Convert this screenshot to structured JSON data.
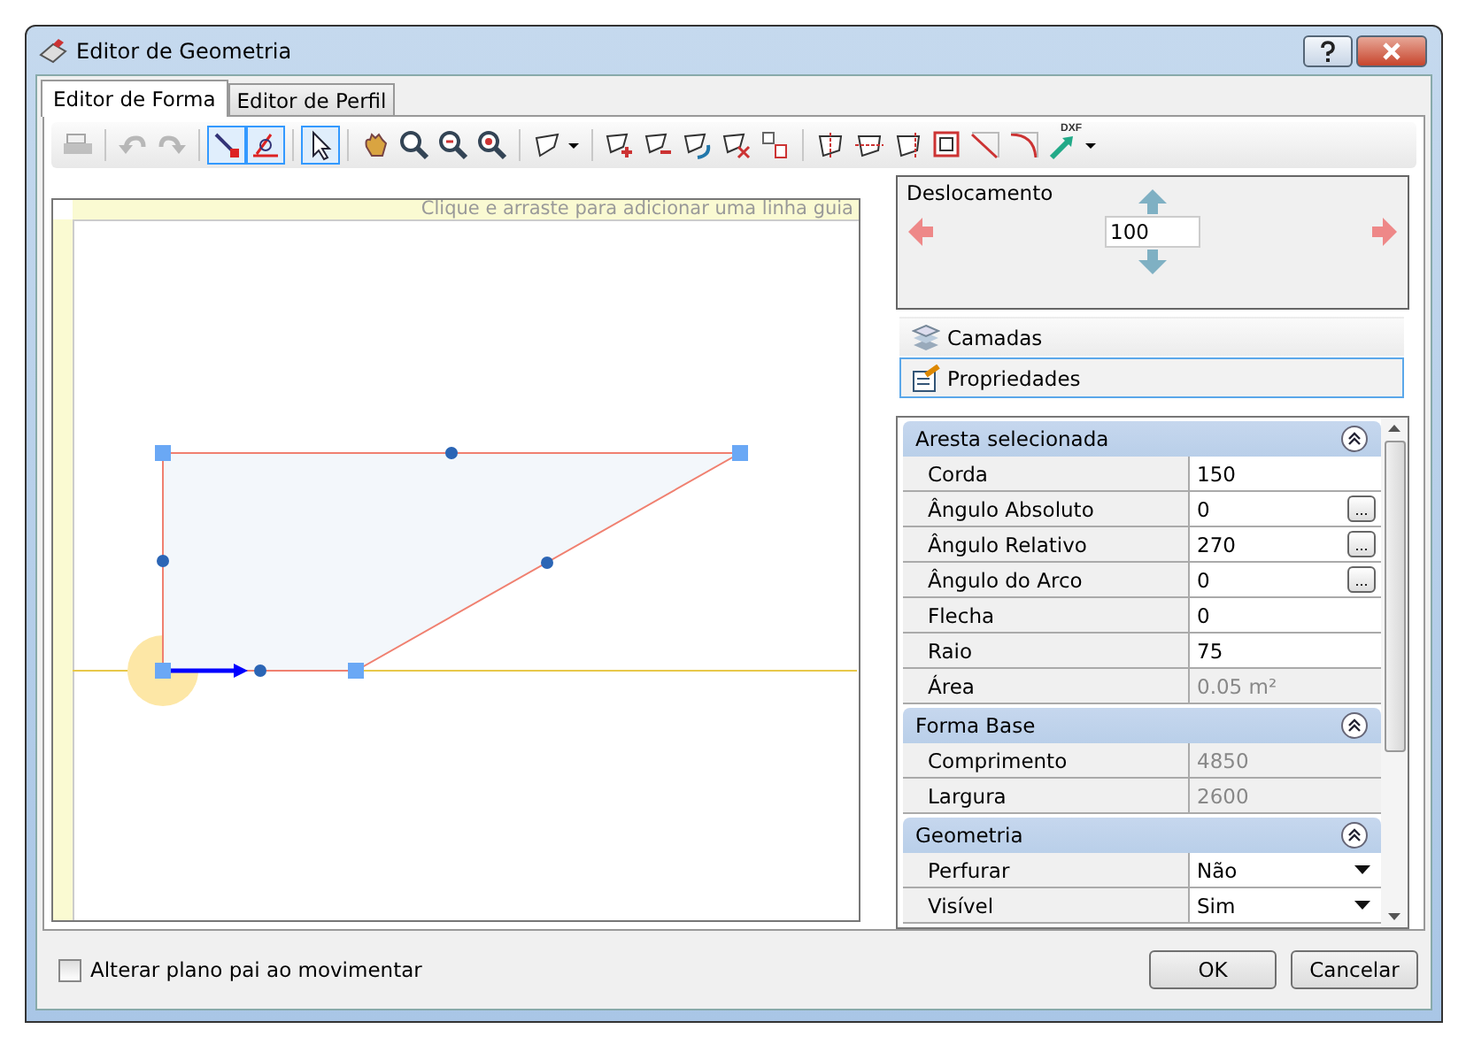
{
  "window": {
    "title": "Editor de Geometria"
  },
  "tabs": [
    {
      "label": "Editor de Forma",
      "selected": true
    },
    {
      "label": "Editor de Perfil",
      "selected": false
    }
  ],
  "toolbar": [
    {
      "selected": false,
      "disabled": true
    },
    {
      "selected": false,
      "disabled": true
    },
    {
      "selected": false,
      "disabled": true
    },
    {
      "selected": true,
      "disabled": false
    },
    {
      "selected": true,
      "disabled": false
    },
    {
      "selected": true,
      "disabled": false
    },
    {
      "selected": false,
      "disabled": false
    },
    {
      "selected": false,
      "disabled": false
    },
    {
      "selected": false,
      "disabled": false
    },
    {
      "selected": false,
      "disabled": false
    },
    {
      "selected": false,
      "disabled": false
    },
    {
      "selected": false,
      "disabled": false
    },
    {
      "selected": false,
      "disabled": false
    },
    {
      "selected": false,
      "disabled": false
    },
    {
      "selected": false,
      "disabled": false
    },
    {
      "selected": false,
      "disabled": false
    },
    {
      "selected": false,
      "disabled": false
    },
    {
      "selected": false,
      "disabled": false
    },
    {
      "selected": false,
      "disabled": false
    },
    {
      "selected": false,
      "disabled": false
    },
    {
      "selected": false,
      "disabled": false
    },
    {
      "selected": false,
      "disabled": false
    },
    {
      "selected": false,
      "disabled": false
    }
  ],
  "dxf_label": "DXF",
  "canvas": {
    "guide_hint": "Clique e arraste para adicionar uma linha guia"
  },
  "offset": {
    "title": "Deslocamento",
    "value": "100"
  },
  "panels": [
    {
      "label": "Camadas",
      "selected": false
    },
    {
      "label": "Propriedades",
      "selected": true
    }
  ],
  "sections": [
    {
      "title": "Aresta selecionada",
      "expanded": true,
      "rows": [
        {
          "label": "Corda",
          "value": "150",
          "kind": "text"
        },
        {
          "label": "Ângulo Absoluto",
          "value": "0",
          "kind": "button"
        },
        {
          "label": "Ângulo Relativo",
          "value": "270",
          "kind": "button"
        },
        {
          "label": "Ângulo do Arco",
          "value": "0",
          "kind": "button"
        },
        {
          "label": "Flecha",
          "value": "0",
          "kind": "text"
        },
        {
          "label": "Raio",
          "value": "75",
          "kind": "text"
        },
        {
          "label": "Área",
          "value": "0.05 m²",
          "kind": "readonly"
        }
      ]
    },
    {
      "title": "Forma Base",
      "expanded": true,
      "rows": [
        {
          "label": "Comprimento",
          "value": "4850",
          "kind": "readonly"
        },
        {
          "label": "Largura",
          "value": "2600",
          "kind": "readonly"
        }
      ]
    },
    {
      "title": "Geometria",
      "expanded": true,
      "rows": [
        {
          "label": "Perfurar",
          "value": "Não",
          "kind": "dropdown"
        },
        {
          "label": "Visível",
          "value": "Sim",
          "kind": "dropdown"
        }
      ]
    }
  ],
  "ellipsis_label": "...",
  "move_parent": {
    "label": "Alterar plano pai ao movimentar",
    "checked": false
  },
  "buttons": [
    "OK",
    "Cancelar"
  ]
}
